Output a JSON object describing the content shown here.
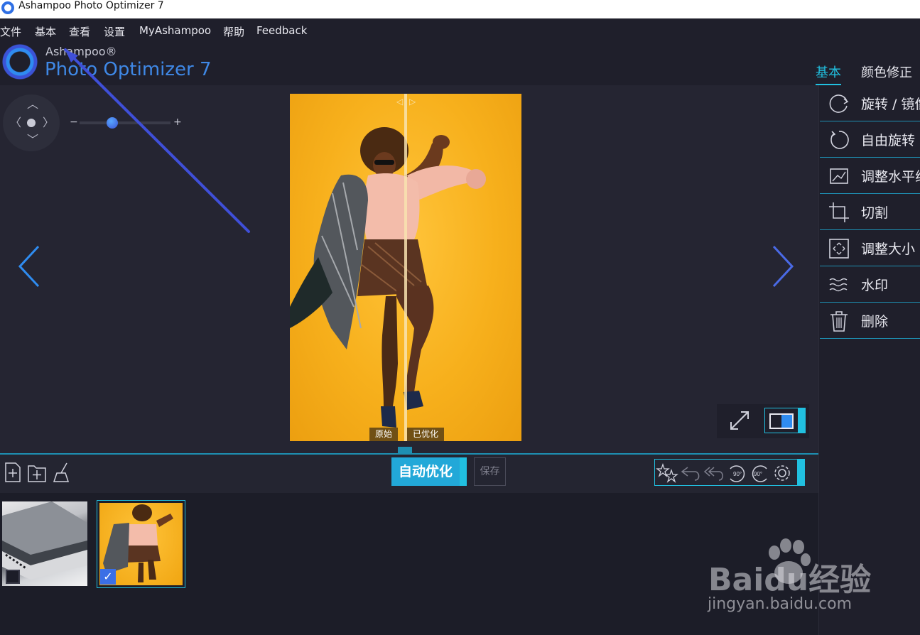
{
  "window": {
    "title": "Ashampoo Photo Optimizer 7"
  },
  "menubar": {
    "items": [
      "文件",
      "基本",
      "查看",
      "设置",
      "MyAshampoo",
      "帮助",
      "Feedback"
    ]
  },
  "logo": {
    "brand": "Ashampoo®",
    "product": "Photo Optimizer 7"
  },
  "right_tabs": [
    {
      "label": "基本",
      "active": true
    },
    {
      "label": "颜色修正",
      "active": false
    }
  ],
  "side_panel": {
    "items": [
      {
        "label": "旋转 / 镜像",
        "icon": "rotate-mirror-icon"
      },
      {
        "label": "自由旋转",
        "icon": "free-rotate-icon"
      },
      {
        "label": "调整水平线",
        "icon": "straighten-icon"
      },
      {
        "label": "切割",
        "icon": "crop-icon"
      },
      {
        "label": "调整大小",
        "icon": "resize-icon"
      },
      {
        "label": "水印",
        "icon": "watermark-icon"
      },
      {
        "label": "删除",
        "icon": "trash-icon"
      }
    ]
  },
  "viewer": {
    "compare_labels": {
      "original": "原始",
      "optimized": "已优化"
    }
  },
  "toolbar": {
    "auto_optimize_label": "自动优化",
    "save_label": "保存"
  },
  "filmstrip": {
    "items": [
      {
        "name": "notebooks-photo",
        "checked": false
      },
      {
        "name": "dancer-photo",
        "checked": true,
        "selected": true
      }
    ]
  },
  "watermark": {
    "brand": "Baidu经验",
    "url": "jingyan.baidu.com"
  },
  "colors": {
    "accent": "#21c0e0",
    "brand_blue": "#3f88e6",
    "background": "#1f1f2b",
    "viewer_bg": "#252532"
  }
}
